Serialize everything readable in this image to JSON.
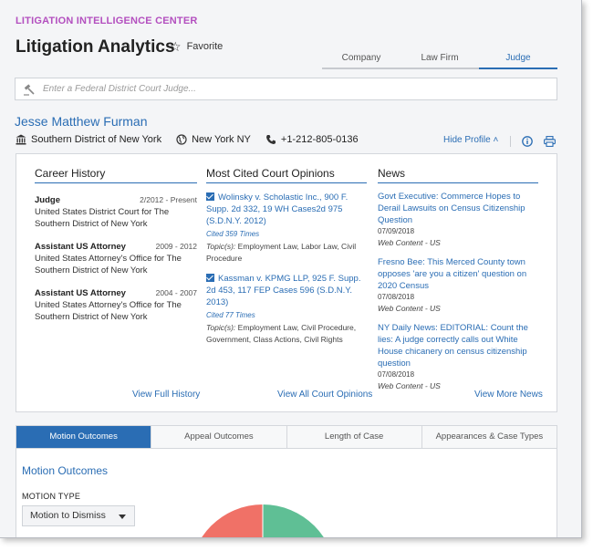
{
  "header": {
    "brand": "LITIGATION INTELLIGENCE CENTER",
    "title": "Litigation Analytics",
    "favorite_label": "Favorite"
  },
  "entity_tabs": [
    {
      "label": "Company",
      "active": false
    },
    {
      "label": "Law Firm",
      "active": false
    },
    {
      "label": "Judge",
      "active": true
    }
  ],
  "search": {
    "placeholder": "Enter a Federal District Court Judge...",
    "value": ""
  },
  "judge": {
    "name": "Jesse Matthew Furman",
    "court": "Southern District of New York",
    "location": "New York NY",
    "phone": "+1-212-805-0136",
    "hide_profile_label": "Hide Profile ˄"
  },
  "career": {
    "heading": "Career History",
    "items": [
      {
        "role": "Judge",
        "dates": "2/2012 - Present",
        "org": "United States District Court for The Southern District of New York"
      },
      {
        "role": "Assistant US Attorney",
        "dates": "2009 - 2012",
        "org": "United States Attorney's Office for The Southern District of New York"
      },
      {
        "role": "Assistant US Attorney",
        "dates": "2004 - 2007",
        "org": "United States Attorney's Office for The Southern District of New York"
      }
    ],
    "link": "View Full History"
  },
  "opinions": {
    "heading": "Most Cited Court Opinions",
    "items": [
      {
        "title": "Wolinsky v. Scholastic Inc., 900 F. Supp. 2d 332, 19 WH Cases2d 975 (S.D.N.Y. 2012)",
        "cited": "Cited 359 Times",
        "topics_label": "Topic(s):",
        "topics": "Employment Law, Labor Law, Civil Procedure"
      },
      {
        "title": "Kassman v. KPMG LLP, 925 F. Supp. 2d 453, 117 FEP Cases 596 (S.D.N.Y. 2013)",
        "cited": "Cited 77 Times",
        "topics_label": "Topic(s):",
        "topics": "Employment Law, Civil Procedure, Government, Class Actions, Civil Rights"
      }
    ],
    "link": "View All Court Opinions"
  },
  "news": {
    "heading": "News",
    "items": [
      {
        "title": "Govt Executive: Commerce Hopes to Derail Lawsuits on Census Citizenship Question",
        "date": "07/09/2018",
        "source": "Web Content - US"
      },
      {
        "title": "Fresno Bee: This Merced County town opposes 'are you a citizen' question on 2020 Census",
        "date": "07/08/2018",
        "source": "Web Content - US"
      },
      {
        "title": "NY Daily News: EDITORIAL: Count the lies: A judge correctly calls out White House chicanery on census citizenship question",
        "date": "07/08/2018",
        "source": "Web Content - US"
      }
    ],
    "link": "View More News"
  },
  "analytics_tabs": [
    {
      "label": "Motion Outcomes",
      "active": true
    },
    {
      "label": "Appeal Outcomes",
      "active": false
    },
    {
      "label": "Length of Case",
      "active": false
    },
    {
      "label": "Appearances & Case Types",
      "active": false
    }
  ],
  "motion": {
    "section_title": "Motion Outcomes",
    "type_label": "MOTION TYPE",
    "selected": "Motion to Dismiss"
  },
  "colors": {
    "accent": "#2a6db4",
    "brand": "#b34fbf",
    "pie_red": "#f07167",
    "pie_green": "#5fbf95"
  }
}
